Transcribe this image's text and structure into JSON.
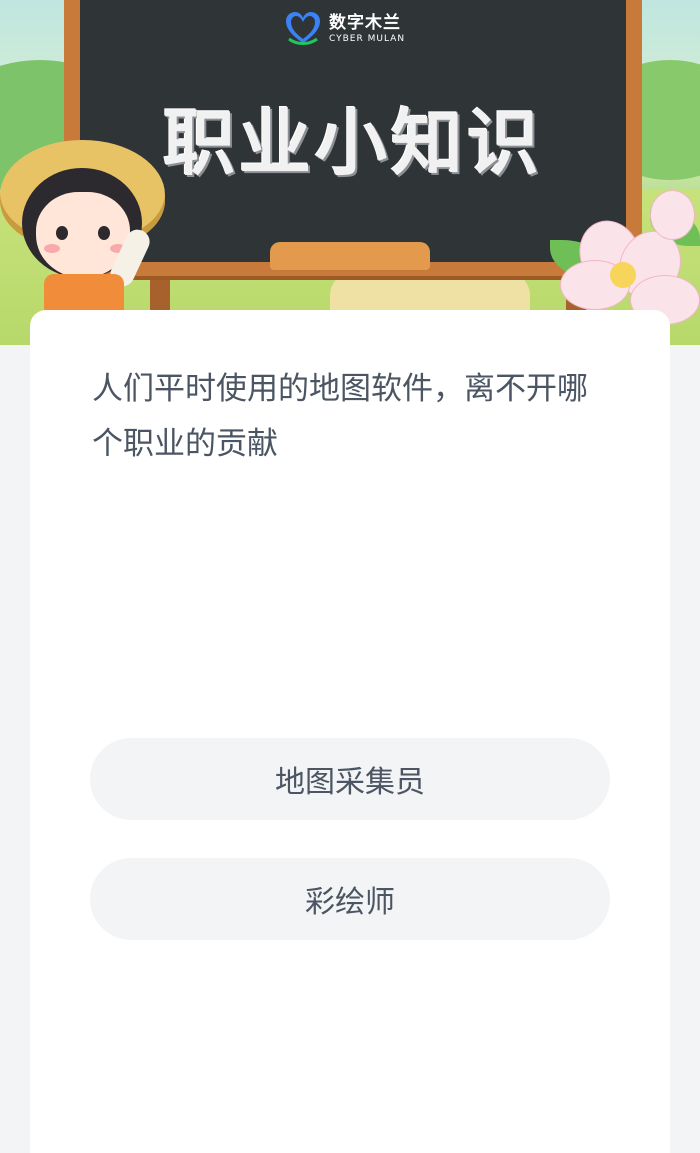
{
  "banner": {
    "logo_cn": "数字木兰",
    "logo_en": "CYBER MULAN",
    "title": "职业小知识"
  },
  "question": {
    "text": "人们平时使用的地图软件，离不开哪个职业的贡献"
  },
  "options": [
    {
      "label": "地图采集员"
    },
    {
      "label": "彩绘师"
    }
  ],
  "colors": {
    "page_bg": "#f3f4f6",
    "card_bg": "#ffffff",
    "option_bg": "#f3f4f6",
    "text": "#4b5563",
    "board": "#2f3437",
    "board_frame": "#c77a3a"
  },
  "icons": {
    "logo": "heart-logo-icon"
  }
}
